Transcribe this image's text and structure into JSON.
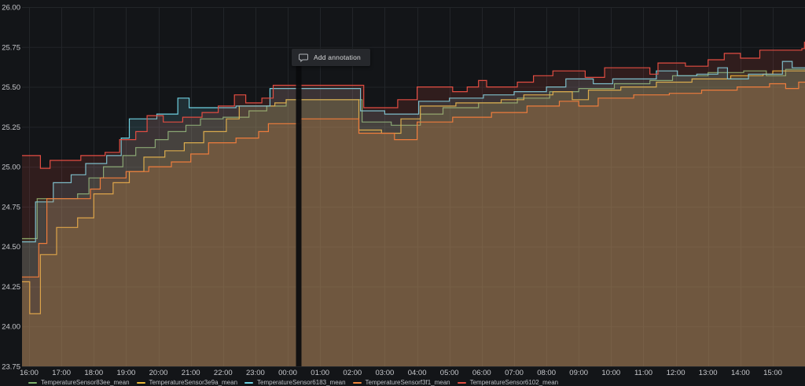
{
  "panel": {
    "tooltip": {
      "label": "Add annotation",
      "icon": "comment-icon"
    }
  },
  "chart_data": {
    "type": "area",
    "step_interpolation": true,
    "title": "",
    "xlabel": "",
    "ylabel": "",
    "x_unit_hours_from": "16:00",
    "xlim_hours": [
      -0.22,
      24.05
    ],
    "ylim": [
      23.75,
      26.0
    ],
    "grid": true,
    "legend_position": "bottom",
    "background_color": "#131518",
    "gridline_color": "#222529",
    "axis_text_color": "#c8c9cd",
    "y_tick_labels": [
      "26.00",
      "25.75",
      "25.50",
      "25.25",
      "25.00",
      "24.75",
      "24.50",
      "24.25",
      "24.00",
      "23.75"
    ],
    "y_tick_values": [
      26.0,
      25.75,
      25.5,
      25.25,
      25.0,
      24.75,
      24.5,
      24.25,
      24.0,
      23.75
    ],
    "x_tick_labels": [
      "16:00",
      "17:00",
      "18:00",
      "19:00",
      "20:00",
      "21:00",
      "22:00",
      "23:00",
      "00:00",
      "01:00",
      "02:00",
      "03:00",
      "04:00",
      "05:00",
      "06:00",
      "07:00",
      "08:00",
      "09:00",
      "10:00",
      "11:00",
      "12:00",
      "13:00",
      "14:00",
      "15:00"
    ],
    "x_tick_hours": [
      0,
      1,
      2,
      3,
      4,
      5,
      6,
      7,
      8,
      9,
      10,
      11,
      12,
      13,
      14,
      15,
      16,
      17,
      18,
      19,
      20,
      21,
      22,
      23
    ],
    "annotation_cursor": {
      "t_hours": 8.34,
      "time_label": "00:20",
      "color": "#0a0b0d"
    },
    "series": [
      {
        "name": "TemperatureSensor83ee_mean",
        "color": "#7EB26D",
        "points": [
          [
            -0.22,
            24.55
          ],
          [
            0.25,
            24.8
          ],
          [
            1.5,
            24.83
          ],
          [
            1.85,
            24.93
          ],
          [
            2.3,
            25.0
          ],
          [
            2.9,
            25.07
          ],
          [
            3.3,
            25.12
          ],
          [
            3.9,
            25.17
          ],
          [
            4.3,
            25.22
          ],
          [
            4.85,
            25.26
          ],
          [
            5.3,
            25.3
          ],
          [
            6.0,
            25.31
          ],
          [
            6.8,
            25.35
          ],
          [
            7.35,
            25.38
          ],
          [
            7.95,
            25.42
          ],
          [
            10.3,
            25.28
          ],
          [
            11.2,
            25.26
          ],
          [
            12.1,
            25.33
          ],
          [
            12.8,
            25.37
          ],
          [
            13.9,
            25.4
          ],
          [
            15.1,
            25.43
          ],
          [
            16.1,
            25.47
          ],
          [
            17.0,
            25.49
          ],
          [
            18.1,
            25.52
          ],
          [
            19.2,
            25.54
          ],
          [
            19.9,
            25.57
          ],
          [
            21.0,
            25.59
          ],
          [
            22.1,
            25.6
          ],
          [
            22.8,
            25.57
          ],
          [
            23.4,
            25.61
          ],
          [
            24.05,
            25.62
          ]
        ]
      },
      {
        "name": "TemperatureSensor3e9a_mean",
        "color": "#EAB839",
        "points": [
          [
            -0.22,
            24.28
          ],
          [
            0.02,
            24.08
          ],
          [
            0.35,
            24.45
          ],
          [
            0.85,
            24.62
          ],
          [
            1.5,
            24.68
          ],
          [
            2.0,
            24.83
          ],
          [
            2.6,
            24.9
          ],
          [
            3.1,
            24.97
          ],
          [
            3.55,
            25.06
          ],
          [
            4.2,
            25.1
          ],
          [
            4.8,
            25.15
          ],
          [
            5.4,
            25.22
          ],
          [
            6.1,
            25.3
          ],
          [
            6.5,
            25.38
          ],
          [
            7.6,
            25.4
          ],
          [
            7.95,
            25.42
          ],
          [
            10.2,
            25.23
          ],
          [
            10.9,
            25.21
          ],
          [
            11.5,
            25.3
          ],
          [
            12.1,
            25.38
          ],
          [
            13.2,
            25.4
          ],
          [
            14.6,
            25.42
          ],
          [
            15.3,
            25.45
          ],
          [
            16.2,
            25.47
          ],
          [
            16.8,
            25.42
          ],
          [
            17.3,
            25.48
          ],
          [
            18.3,
            25.5
          ],
          [
            19.4,
            25.53
          ],
          [
            20.5,
            25.55
          ],
          [
            21.7,
            25.57
          ],
          [
            22.7,
            25.58
          ],
          [
            23.0,
            25.6
          ],
          [
            24.05,
            25.6
          ]
        ]
      },
      {
        "name": "TemperatureSensor6183_mean",
        "color": "#6ED0E0",
        "points": [
          [
            -0.22,
            24.53
          ],
          [
            0.2,
            24.78
          ],
          [
            0.75,
            24.9
          ],
          [
            1.3,
            24.95
          ],
          [
            1.75,
            25.02
          ],
          [
            2.4,
            25.07
          ],
          [
            2.85,
            25.18
          ],
          [
            3.1,
            25.3
          ],
          [
            3.95,
            25.33
          ],
          [
            4.6,
            25.43
          ],
          [
            4.95,
            25.37
          ],
          [
            6.4,
            25.38
          ],
          [
            7.45,
            25.49
          ],
          [
            10.25,
            25.35
          ],
          [
            11.0,
            25.33
          ],
          [
            12.05,
            25.41
          ],
          [
            13.0,
            25.43
          ],
          [
            14.05,
            25.45
          ],
          [
            15.0,
            25.47
          ],
          [
            16.0,
            25.5
          ],
          [
            16.6,
            25.55
          ],
          [
            17.45,
            25.52
          ],
          [
            18.05,
            25.55
          ],
          [
            19.4,
            25.6
          ],
          [
            20.05,
            25.57
          ],
          [
            20.65,
            25.58
          ],
          [
            21.3,
            25.62
          ],
          [
            21.6,
            25.55
          ],
          [
            22.25,
            25.58
          ],
          [
            23.3,
            25.66
          ],
          [
            23.6,
            25.62
          ],
          [
            24.05,
            25.65
          ]
        ]
      },
      {
        "name": "TemperatureSensorf3f1_mean",
        "color": "#EF843C",
        "points": [
          [
            -0.22,
            24.31
          ],
          [
            0.3,
            24.52
          ],
          [
            0.55,
            24.8
          ],
          [
            1.9,
            24.86
          ],
          [
            2.2,
            24.93
          ],
          [
            3.0,
            24.97
          ],
          [
            3.7,
            25.0
          ],
          [
            4.4,
            25.03
          ],
          [
            5.0,
            25.08
          ],
          [
            5.55,
            25.15
          ],
          [
            6.4,
            25.18
          ],
          [
            7.1,
            25.22
          ],
          [
            7.4,
            25.27
          ],
          [
            8.4,
            25.3
          ],
          [
            10.2,
            25.21
          ],
          [
            11.3,
            25.17
          ],
          [
            12.0,
            25.28
          ],
          [
            13.1,
            25.31
          ],
          [
            14.3,
            25.34
          ],
          [
            15.4,
            25.38
          ],
          [
            16.4,
            25.41
          ],
          [
            17.0,
            25.38
          ],
          [
            17.6,
            25.43
          ],
          [
            18.7,
            25.45
          ],
          [
            19.8,
            25.46
          ],
          [
            20.8,
            25.48
          ],
          [
            21.9,
            25.5
          ],
          [
            22.9,
            25.52
          ],
          [
            23.4,
            25.49
          ],
          [
            23.8,
            25.53
          ],
          [
            24.05,
            25.53
          ]
        ]
      },
      {
        "name": "TemperatureSensor6102_mean",
        "color": "#E24D42",
        "points": [
          [
            -0.22,
            25.07
          ],
          [
            0.35,
            24.99
          ],
          [
            0.65,
            25.04
          ],
          [
            1.6,
            25.07
          ],
          [
            2.35,
            25.09
          ],
          [
            2.8,
            25.17
          ],
          [
            3.3,
            25.22
          ],
          [
            3.65,
            25.32
          ],
          [
            4.15,
            25.28
          ],
          [
            4.75,
            25.31
          ],
          [
            5.35,
            25.34
          ],
          [
            5.85,
            25.38
          ],
          [
            6.35,
            25.45
          ],
          [
            6.7,
            25.4
          ],
          [
            7.2,
            25.43
          ],
          [
            7.55,
            25.51
          ],
          [
            10.35,
            25.37
          ],
          [
            11.4,
            25.42
          ],
          [
            12.0,
            25.5
          ],
          [
            13.1,
            25.47
          ],
          [
            13.55,
            25.5
          ],
          [
            13.9,
            25.54
          ],
          [
            14.15,
            25.5
          ],
          [
            15.1,
            25.53
          ],
          [
            15.6,
            25.57
          ],
          [
            16.2,
            25.6
          ],
          [
            17.2,
            25.56
          ],
          [
            17.8,
            25.62
          ],
          [
            19.2,
            25.58
          ],
          [
            19.45,
            25.65
          ],
          [
            20.3,
            25.63
          ],
          [
            21.0,
            25.67
          ],
          [
            21.5,
            25.71
          ],
          [
            22.0,
            25.68
          ],
          [
            22.6,
            25.73
          ],
          [
            23.9,
            25.74
          ],
          [
            23.98,
            25.78
          ]
        ]
      }
    ]
  }
}
